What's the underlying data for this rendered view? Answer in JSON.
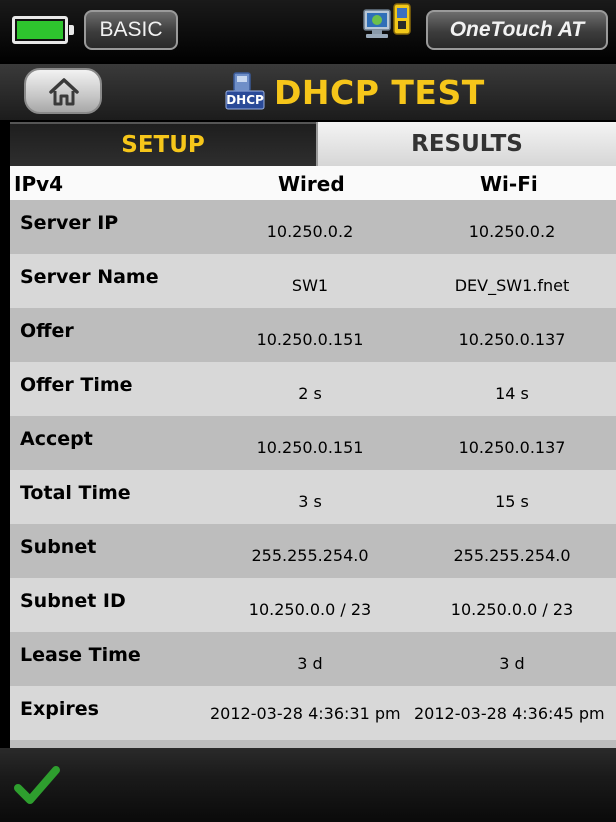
{
  "statusbar": {
    "mode_label": "BASIC",
    "device_label": "OneTouch AT",
    "battery_color": "#2ec42e"
  },
  "titlebar": {
    "title": "DHCP TEST",
    "icon_badge": "DHCP"
  },
  "tabs": [
    {
      "label": "SETUP",
      "active": true
    },
    {
      "label": "RESULTS",
      "active": false
    }
  ],
  "table": {
    "headers": [
      "IPv4",
      "Wired",
      "Wi-Fi"
    ],
    "rows": [
      {
        "label": "Server IP",
        "wired": "10.250.0.2",
        "wifi": "10.250.0.2"
      },
      {
        "label": "Server Name",
        "wired": "SW1",
        "wifi": "DEV_SW1.fnet"
      },
      {
        "label": "Offer",
        "wired": "10.250.0.151",
        "wifi": "10.250.0.137"
      },
      {
        "label": "Offer Time",
        "wired": "2 s",
        "wifi": "14 s"
      },
      {
        "label": "Accept",
        "wired": "10.250.0.151",
        "wifi": "10.250.0.137"
      },
      {
        "label": "Total Time",
        "wired": "3 s",
        "wifi": "15 s"
      },
      {
        "label": "Subnet",
        "wired": "255.255.254.0",
        "wifi": "255.255.254.0"
      },
      {
        "label": "Subnet ID",
        "wired": "10.250.0.0 / 23",
        "wifi": "10.250.0.0 / 23"
      },
      {
        "label": "Lease Time",
        "wired": "3 d",
        "wifi": "3 d"
      },
      {
        "label": "Expires",
        "wired": "2012-03-28 4:36:31 pm",
        "wifi": "2012-03-28 4:36:45 pm"
      }
    ]
  },
  "colors": {
    "accent_yellow": "#f6c61a",
    "check_green": "#2e9e2e"
  },
  "icons": {
    "home": "home-icon",
    "network": "network-devices-icon",
    "dhcp": "dhcp-icon",
    "check": "checkmark-icon"
  }
}
